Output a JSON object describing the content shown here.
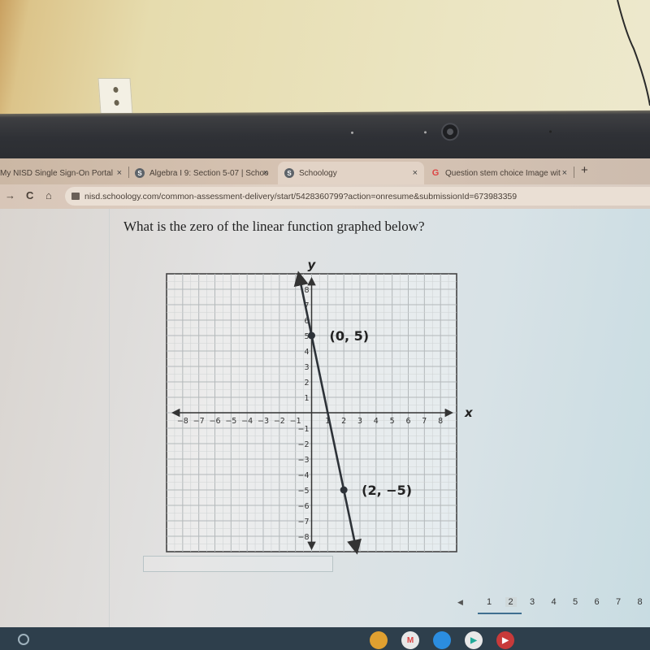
{
  "browser": {
    "tabs": [
      {
        "title": "My NISD Single Sign-On Portal",
        "favicon": "none",
        "active": false
      },
      {
        "title": "Algebra I 9: Section 5-07 | Schoo",
        "favicon": "schoology-icon",
        "favicon_glyph": "S",
        "active": false
      },
      {
        "title": "Schoology",
        "favicon": "schoology-icon",
        "favicon_glyph": "S",
        "active": true
      },
      {
        "title": "Question stem choice Image wit",
        "favicon": "google-icon",
        "favicon_glyph": "G",
        "active": false
      }
    ],
    "close_glyph": "×",
    "new_tab_glyph": "+",
    "nav": {
      "forward_glyph": "→",
      "reload_glyph": "C",
      "home_glyph": "⌂"
    },
    "url": "nisd.schoology.com/common-assessment-delivery/start/5428360799?action=onresume&submissionId=673983359"
  },
  "question": {
    "text": "What is the zero of the linear function graphed below?",
    "answer_value": "",
    "answer_placeholder": ""
  },
  "pagination": {
    "prev_glyph": "◀",
    "pages": [
      "1",
      "2",
      "3",
      "4",
      "5",
      "6",
      "7",
      "8"
    ],
    "current": "2"
  },
  "shelf": {
    "apps": [
      {
        "name": "chrome-icon",
        "glyph": "",
        "color": "#e0a030"
      },
      {
        "name": "gmail-icon",
        "glyph": "M",
        "color": "#e8e8e8"
      },
      {
        "name": "files-icon",
        "glyph": "",
        "color": "#2b8de0"
      },
      {
        "name": "play-store-icon",
        "glyph": "▶",
        "color": "#e8e8e8"
      },
      {
        "name": "youtube-icon",
        "glyph": "▶",
        "color": "#c83a3a"
      }
    ]
  },
  "chart_data": {
    "type": "line",
    "title": "",
    "xlabel": "x",
    "ylabel": "y",
    "xlim": [
      -9,
      9
    ],
    "ylim": [
      -9,
      9
    ],
    "grid": true,
    "grid_minor": 0.5,
    "x_ticks": [
      "-8",
      "-7",
      "-6",
      "-5",
      "-4",
      "-3",
      "-2",
      "-1",
      "1",
      "2",
      "3",
      "4",
      "5",
      "6",
      "7",
      "8"
    ],
    "y_ticks": [
      "8",
      "7",
      "6",
      "5",
      "4",
      "3",
      "2",
      "1",
      "-1",
      "-2",
      "-3",
      "-4",
      "-5",
      "-6",
      "-7",
      "-8"
    ],
    "line": {
      "slope": -5,
      "intercept": 5,
      "x_range": [
        -0.8,
        2.8
      ]
    },
    "points": [
      {
        "x": 0,
        "y": 5,
        "label": "(0, 5)"
      },
      {
        "x": 2,
        "y": -5,
        "label": "(2, −5)"
      }
    ]
  }
}
